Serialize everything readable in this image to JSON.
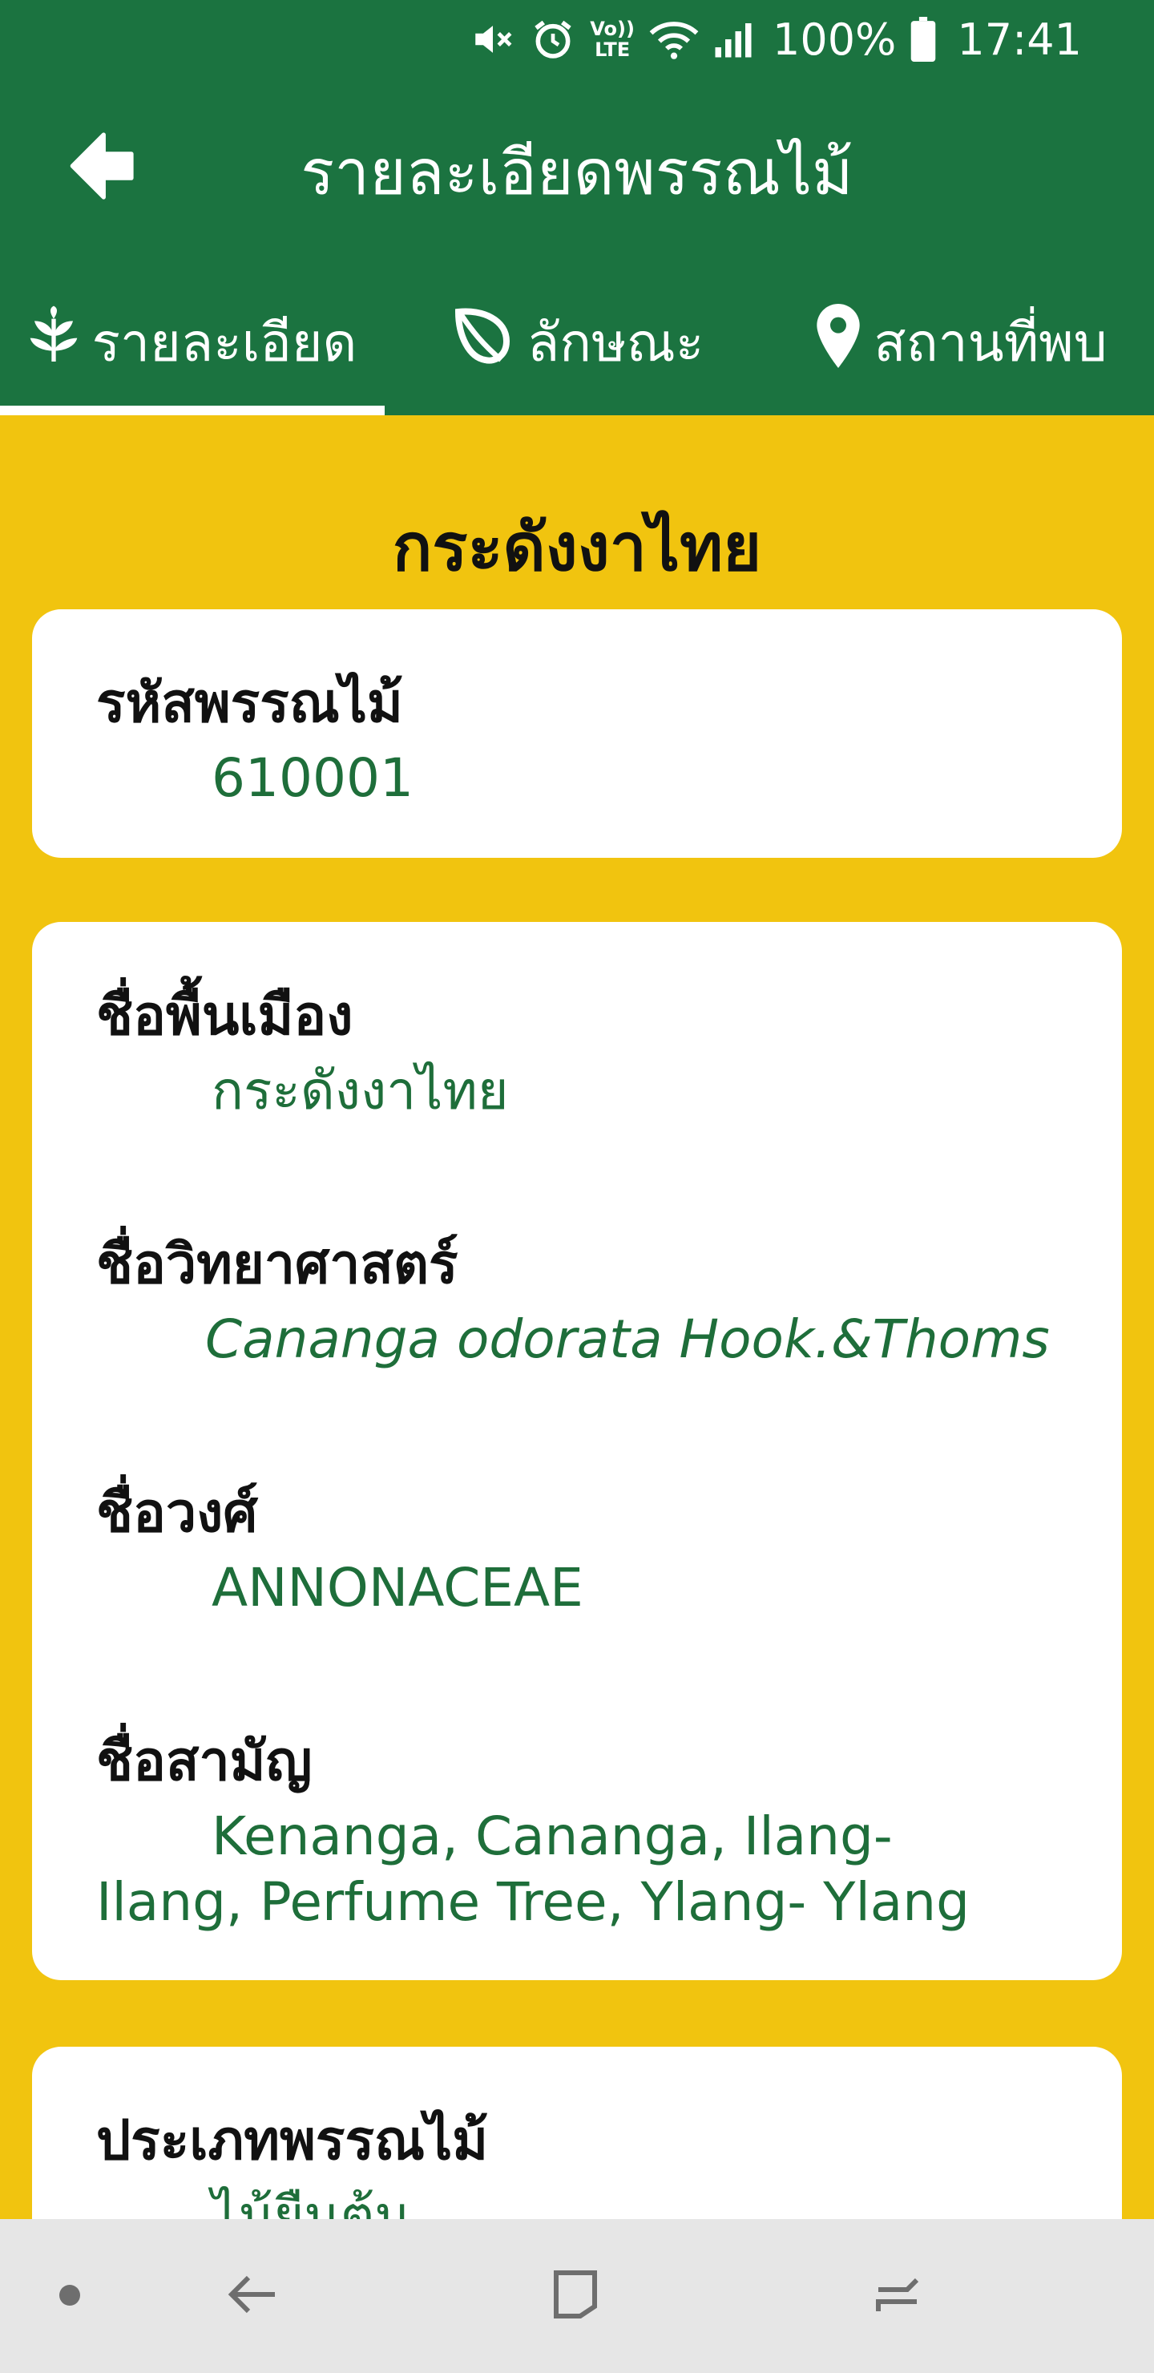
{
  "status_bar": {
    "battery": "100%",
    "time": "17:41",
    "volte_label_top": "Vo))",
    "volte_label_bottom": "LTE",
    "icons": [
      "mute-icon",
      "alarm-icon",
      "volte-icon",
      "wifi-icon",
      "signal-icon",
      "battery-icon"
    ]
  },
  "app_bar": {
    "title": "รายละเอียดพรรณไม้",
    "back_icon": "arrow-left-icon"
  },
  "tabs": [
    {
      "label": "รายละเอียด",
      "icon": "plant-icon",
      "selected": true
    },
    {
      "label": "ลักษณะ",
      "icon": "leaf-icon",
      "selected": false
    },
    {
      "label": "สถานที่พบ",
      "icon": "location-pin-icon",
      "selected": false
    }
  ],
  "plant": {
    "title": "กระดังงาไทย",
    "code": {
      "label": "รหัสพรรณไม้",
      "value": "610001"
    },
    "local_name": {
      "label": "ชื่อพื้นเมือง",
      "value": "กระดังงาไทย"
    },
    "scientific_name": {
      "label": "ชื่อวิทยาศาสตร์",
      "value": "Cananga odorata Hook.&Thoms"
    },
    "family": {
      "label": "ชื่อวงศ์",
      "value": "ANNONACEAE"
    },
    "common_name": {
      "label": "ชื่อสามัญ",
      "value": "Kenanga, Cananga, Ilang-Ilang, Perfume Tree, Ylang- Ylang"
    },
    "plant_type": {
      "label": "ประเภทพรรณไม้",
      "value": "ไม้ยืนต้น"
    }
  },
  "colors": {
    "app_bar": "#1B7340",
    "background": "#F1C40F",
    "value_text": "#1E6E3A",
    "nav_bar": "#E6E6E6"
  }
}
